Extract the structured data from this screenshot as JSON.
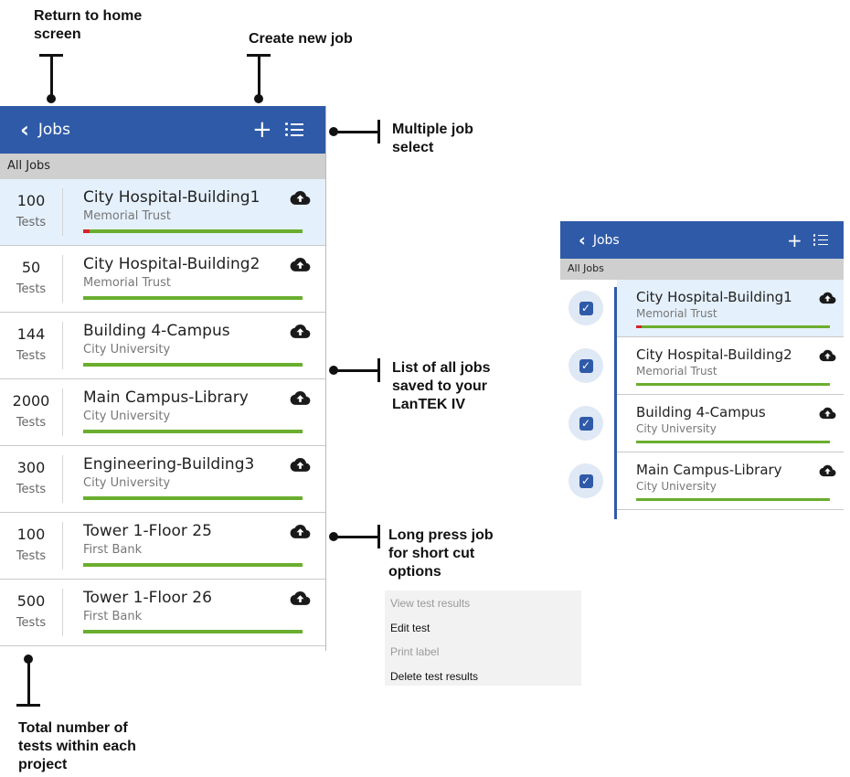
{
  "annotations": {
    "home": "Return to home\nscreen",
    "new_job": "Create new job",
    "multi_select": "Multiple job\nselect",
    "list_all": "List of all jobs\nsaved to your\nLanTEK IV",
    "long_press": "Long press job\nfor short cut\noptions",
    "total_tests": "Total number of\ntests within each\nproject"
  },
  "app": {
    "back_glyph": "‹",
    "title": "Jobs",
    "plus": "+",
    "filter": "All Jobs",
    "tests_label": "Tests"
  },
  "jobs": [
    {
      "count": "100",
      "name": "City Hospital-Building1",
      "client": "Memorial Trust",
      "fail_fraction": 0.03,
      "selected": true
    },
    {
      "count": "50",
      "name": "City Hospital-Building2",
      "client": "Memorial Trust",
      "fail_fraction": 0,
      "selected": false
    },
    {
      "count": "144",
      "name": "Building 4-Campus",
      "client": "City University",
      "fail_fraction": 0,
      "selected": false
    },
    {
      "count": "2000",
      "name": "Main Campus-Library",
      "client": "City University",
      "fail_fraction": 0,
      "selected": false
    },
    {
      "count": "300",
      "name": "Engineering-Building3",
      "client": "City University",
      "fail_fraction": 0,
      "selected": false
    },
    {
      "count": "100",
      "name": "Tower 1-Floor 25",
      "client": "First Bank",
      "fail_fraction": 0,
      "selected": false
    },
    {
      "count": "500",
      "name": "Tower 1-Floor 26",
      "client": "First Bank",
      "fail_fraction": 0,
      "selected": false
    }
  ],
  "multi_select_view": {
    "check_glyph": "✓",
    "checked_count": 4
  },
  "context_menu": [
    {
      "label": "View test results",
      "enabled": false
    },
    {
      "label": "Edit test",
      "enabled": true
    },
    {
      "label": "Print label",
      "enabled": false
    },
    {
      "label": "Delete test results",
      "enabled": true
    }
  ],
  "colors": {
    "app_bar": "#2f5aa8",
    "filter_bar": "#cfcfcf",
    "selected_row": "#e4f0fb",
    "progress_pass": "#6aae2e",
    "progress_fail": "#d6232a"
  }
}
